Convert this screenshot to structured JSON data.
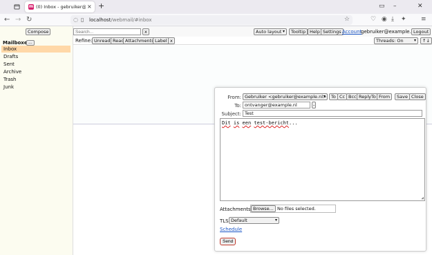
{
  "browser": {
    "tab_title": "(0) Inbox - gebruiker@ex",
    "tab_favicon": "m",
    "url_host": "localhost",
    "url_path": "/webmail/#inbox"
  },
  "sidebar": {
    "compose_label": "Compose",
    "mailboxes_title": "Mailboxes",
    "mailboxes_menu": "...",
    "items": [
      {
        "label": "Inbox"
      },
      {
        "label": "Drafts"
      },
      {
        "label": "Sent"
      },
      {
        "label": "Archive"
      },
      {
        "label": "Trash"
      },
      {
        "label": "Junk"
      }
    ]
  },
  "topbar": {
    "search_placeholder": "Search...",
    "search_clear": "x",
    "layout_select": "Auto layout",
    "tooltip_label": "Tooltip",
    "help_label": "Help",
    "settings_label": "Settings",
    "account_label": "Account",
    "user_email": "gebruiker@example.nl",
    "logout_label": "Logout"
  },
  "refine": {
    "label": "Refine:",
    "filters": [
      "Unread",
      "Read",
      "Attachments",
      "Label"
    ],
    "clear": "x",
    "threads_select": "Threads: On",
    "sort_label": "↑↓"
  },
  "compose": {
    "from_label": "From:",
    "from_value": "Gebruiker <gebruiker@example.nl>",
    "to_btn": "To",
    "cc_btn": "Cc",
    "bcc_btn": "Bcc",
    "replyto_btn": "ReplyTo",
    "from_btn": "From",
    "save_label": "Save",
    "close_label": "Close",
    "to_label": "To:",
    "to_value": "ontvanger@example.nl",
    "to_remove": "-",
    "subject_label": "Subject:",
    "subject_value": "Test",
    "body_w1": "Dit",
    "body_w2": "is",
    "body_w3": "een",
    "body_w4": "test-bericht",
    "body_end": "...",
    "attachments_label": "Attachments",
    "browse_label": "Browse...",
    "files_status": "No files selected.",
    "tls_label": "TLS",
    "tls_value": "Default",
    "schedule_label": "Schedule",
    "send_label": "Send"
  }
}
